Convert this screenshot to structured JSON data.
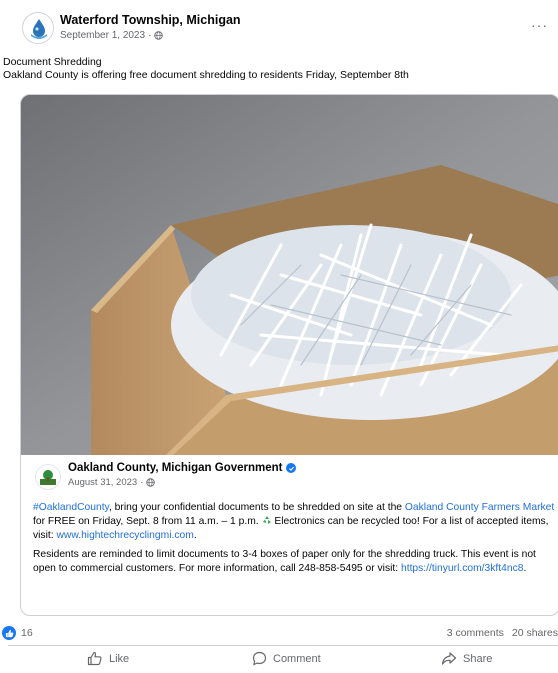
{
  "post": {
    "page_name": "Waterford Township, Michigan",
    "date": "September 1, 2023",
    "date_separator": "·",
    "more_label": "···",
    "text_line1": "Document Shredding",
    "text_line2": "Oakland County is offering free document shredding to residents Friday, September 8th"
  },
  "shared": {
    "page_name": "Oakland County, Michigan Government",
    "date": "August 31, 2023",
    "date_separator": "·",
    "p1": {
      "hashtag": "#OaklandCounty",
      "t1": ", bring your confidential documents to be shredded on site at the ",
      "market_link": "Oakland County Farmers Market",
      "t2": " for FREE on Friday, Sept. 8 from 11 a.m. – 1 p.m. ",
      "t3": " Electronics can be recycled too! For a list of accepted items, visit: ",
      "recycle_link": "www.hightechrecyclingmi.com",
      "t4": "."
    },
    "p2": {
      "t1": "Residents are reminded to limit documents to 3-4 boxes of paper only for the shredding truck. This event is not open to commercial customers. For more information, call 248-858-5495 or visit: ",
      "tinyurl": "https://tinyurl.com/3kft4nc8",
      "t2": "."
    }
  },
  "stats": {
    "reaction_count": "16",
    "comments": "3 comments",
    "shares": "20 shares"
  },
  "actions": {
    "like": "Like",
    "comment": "Comment",
    "share": "Share"
  },
  "colors": {
    "accent": "#1877f2",
    "link": "#216fdb",
    "secondary_text": "#65676b"
  },
  "icons": {
    "page_avatar": "water-drop-logo-icon",
    "audience": "globe-icon",
    "shared_avatar": "oakland-county-logo-icon",
    "verified": "verified-badge-icon",
    "recycle": "recycle-icon",
    "reaction": "like-reaction-icon",
    "like": "thumbs-up-icon",
    "comment": "comment-bubble-icon",
    "share": "share-arrow-icon"
  }
}
